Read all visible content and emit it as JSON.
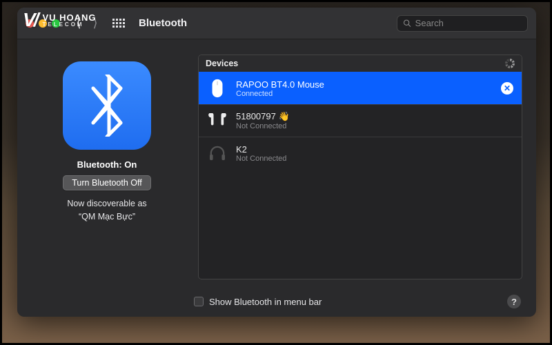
{
  "watermark": {
    "brand": "VU HOANG",
    "sub": "TELECOM"
  },
  "titlebar": {
    "title": "Bluetooth",
    "search_placeholder": "Search"
  },
  "left": {
    "status": "Bluetooth: On",
    "toggle_label": "Turn Bluetooth Off",
    "discover_line1": "Now discoverable as",
    "discover_line2": "“QM Mạc Bực”"
  },
  "devices_header": "Devices",
  "devices": [
    {
      "name": "RAPOO BT4.0 Mouse",
      "status": "Connected",
      "selected": true,
      "icon": "mouse",
      "action": "remove"
    },
    {
      "name": "51800797",
      "status": "Not Connected",
      "selected": false,
      "icon": "airpods",
      "extra": "👋"
    },
    {
      "name": "K2",
      "status": "Not Connected",
      "selected": false,
      "icon": "headphones"
    }
  ],
  "footer": {
    "checkbox_label": "Show Bluetooth in menu bar"
  }
}
